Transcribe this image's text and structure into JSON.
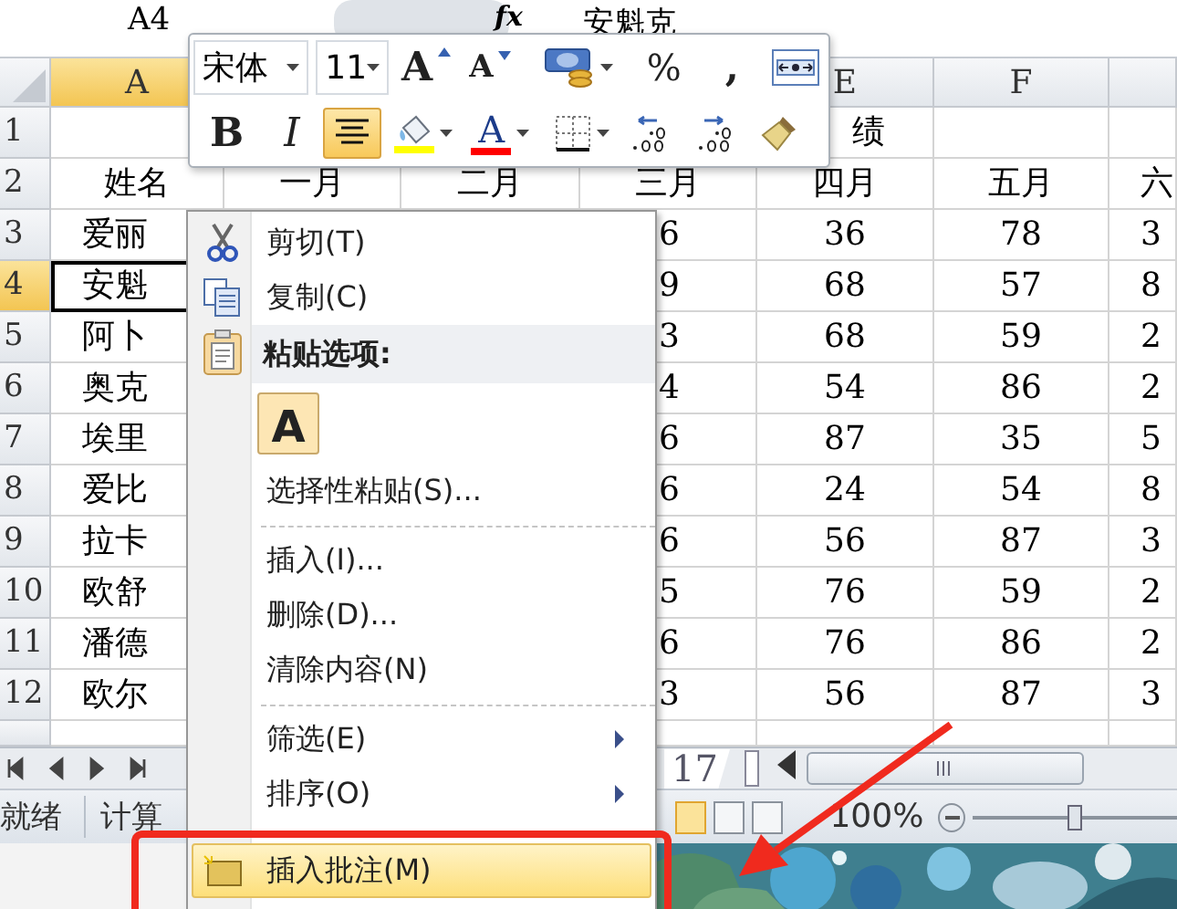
{
  "formula_bar": {
    "name_box": "A4",
    "function_label": "fx",
    "content": "安魁克"
  },
  "mini_toolbar": {
    "font": "宋体",
    "font_size": "11",
    "row_1": [
      {
        "kind": "grow-font",
        "label": "A"
      },
      {
        "kind": "shrink-font",
        "label": "A"
      },
      {
        "kind": "accounting"
      },
      {
        "kind": "percent",
        "label": "%"
      },
      {
        "kind": "comma",
        "label": ","
      },
      {
        "kind": "merge-center"
      }
    ],
    "row_2": [
      {
        "kind": "bold",
        "label": "B",
        "selected": false
      },
      {
        "kind": "italic",
        "label": "I",
        "selected": false
      },
      {
        "kind": "align-center",
        "selected": true
      },
      {
        "kind": "fill-color",
        "color": "#ffff00"
      },
      {
        "kind": "font-color",
        "label": "A",
        "color": "#ff0000"
      },
      {
        "kind": "borders"
      },
      {
        "kind": "increase-decimal"
      },
      {
        "kind": "decrease-decimal"
      },
      {
        "kind": "format-painter"
      }
    ]
  },
  "sheet": {
    "column_headers": [
      {
        "label": "A",
        "selected": true
      },
      {
        "label": "E",
        "selected": false
      },
      {
        "label": "F",
        "selected": false
      }
    ],
    "rows": [
      {
        "number": "1",
        "selected": false,
        "title": "绩"
      },
      {
        "number": "2",
        "selected": false,
        "cells": [
          "姓名",
          "一月",
          "二月",
          "三月",
          "四月",
          "五月",
          "六"
        ]
      },
      {
        "number": "3",
        "selected": false,
        "cells": [
          "爱丽",
          "6",
          "36",
          "78",
          "3"
        ]
      },
      {
        "number": "4",
        "selected": true,
        "cells": [
          "安魁",
          "9",
          "68",
          "57",
          "8"
        ]
      },
      {
        "number": "5",
        "selected": false,
        "cells": [
          "阿卜",
          "3",
          "68",
          "59",
          "2"
        ]
      },
      {
        "number": "6",
        "selected": false,
        "cells": [
          "奥克",
          "4",
          "54",
          "86",
          "2"
        ]
      },
      {
        "number": "7",
        "selected": false,
        "cells": [
          "埃里",
          "6",
          "87",
          "35",
          "5"
        ]
      },
      {
        "number": "8",
        "selected": false,
        "cells": [
          "爱比",
          "6",
          "24",
          "54",
          "8"
        ]
      },
      {
        "number": "9",
        "selected": false,
        "cells": [
          "拉卡",
          "6",
          "56",
          "87",
          "3"
        ]
      },
      {
        "number": "10",
        "selected": false,
        "cells": [
          "欧舒",
          "5",
          "76",
          "59",
          "2"
        ]
      },
      {
        "number": "11",
        "selected": false,
        "cells": [
          "潘德",
          "6",
          "76",
          "86",
          "2"
        ]
      },
      {
        "number": "12",
        "selected": false,
        "cells": [
          "欧尔",
          "3",
          "56",
          "87",
          "3"
        ]
      }
    ]
  },
  "context_menu": [
    {
      "kind": "cut",
      "label": "剪切(T)",
      "selected": false
    },
    {
      "kind": "copy",
      "label": "复制(C)",
      "selected": false
    },
    {
      "kind": "heading",
      "label": "粘贴选项:"
    },
    {
      "kind": "paste",
      "label": "A"
    },
    {
      "kind": "plain",
      "label": "选择性粘贴(S)...",
      "selected": false
    },
    {
      "kind": "separator"
    },
    {
      "kind": "plain",
      "label": "插入(I)...",
      "selected": false
    },
    {
      "kind": "plain",
      "label": "删除(D)...",
      "selected": false
    },
    {
      "kind": "plain",
      "label": "清除内容(N)",
      "selected": false
    },
    {
      "kind": "separator"
    },
    {
      "kind": "submenu",
      "label": "筛选(E)",
      "selected": false
    },
    {
      "kind": "submenu",
      "label": "排序(O)",
      "selected": false
    },
    {
      "kind": "comment",
      "label": "插入批注(M)",
      "selected": true
    }
  ],
  "sheet_tabs": {
    "tab": "17"
  },
  "status_bar": {
    "messages": [
      "就绪",
      "计算"
    ],
    "views": [
      {
        "selected": true
      },
      {
        "selected": false
      },
      {
        "selected": false
      }
    ],
    "zoom": "100%",
    "zoom_slider": {
      "level": 0.5
    }
  }
}
